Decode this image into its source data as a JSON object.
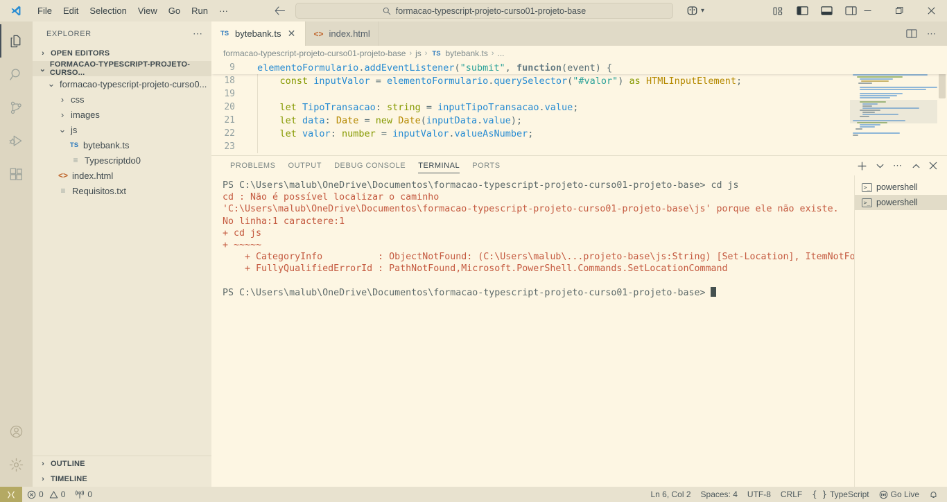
{
  "titlebar": {
    "menus": [
      "File",
      "Edit",
      "Selection",
      "View",
      "Go",
      "Run",
      "···"
    ],
    "search_value": "formacao-typescript-projeto-curso01-projeto-base",
    "search_icon": "search-icon",
    "back_icon": "arrow-left-icon",
    "forward_icon": "arrow-right-icon",
    "accounts_icon": "remote-explorer-icon",
    "layout_icons": [
      "customize-layout-icon",
      "toggle-primary-sidebar-icon",
      "toggle-panel-icon",
      "toggle-secondary-sidebar-icon"
    ],
    "window": {
      "minimize": "─",
      "maximize": "❐",
      "close": "✕"
    }
  },
  "activitybar": {
    "items": [
      {
        "name": "explorer",
        "icon": "files-icon",
        "active": true
      },
      {
        "name": "search",
        "icon": "search-icon",
        "active": false
      },
      {
        "name": "source-control",
        "icon": "source-control-icon",
        "active": false
      },
      {
        "name": "run-and-debug",
        "icon": "run-debug-icon",
        "active": false
      },
      {
        "name": "extensions",
        "icon": "extensions-icon",
        "active": false
      }
    ],
    "bottom": [
      {
        "name": "accounts",
        "icon": "account-icon"
      },
      {
        "name": "manage",
        "icon": "gear-icon"
      }
    ]
  },
  "sidebar": {
    "title": "EXPLORER",
    "more_actions": "⋯",
    "sections": [
      {
        "label": "OPEN EDITORS",
        "expanded": false
      },
      {
        "label": "FORMACAO-TYPESCRIPT-PROJETO-CURSO...",
        "expanded": true
      }
    ],
    "tree": [
      {
        "label": "formacao-typescript-projeto-curso0...",
        "indent": 1,
        "chev": "⌄",
        "icon": "folder",
        "type": "folder"
      },
      {
        "label": "css",
        "indent": 2,
        "chev": "›",
        "icon": "folder",
        "type": "folder"
      },
      {
        "label": "images",
        "indent": 2,
        "chev": "›",
        "icon": "folder",
        "type": "folder"
      },
      {
        "label": "js",
        "indent": 2,
        "chev": "⌄",
        "icon": "folder",
        "type": "folder"
      },
      {
        "label": "bytebank.ts",
        "indent": 3,
        "chev": "",
        "icon": "ts-file-icon",
        "type": "ts"
      },
      {
        "label": "Typescriptdo0",
        "indent": 3,
        "chev": "",
        "icon": "text-file-icon",
        "type": "txt"
      },
      {
        "label": "index.html",
        "indent": 2,
        "chev": "",
        "icon": "html-file-icon",
        "type": "html"
      },
      {
        "label": "Requisitos.txt",
        "indent": 2,
        "chev": "",
        "icon": "text-file-icon",
        "type": "txt"
      }
    ],
    "bottom_sections": [
      {
        "label": "OUTLINE",
        "expanded": false
      },
      {
        "label": "TIMELINE",
        "expanded": false
      }
    ]
  },
  "editor": {
    "tabs": [
      {
        "label": "bytebank.ts",
        "icon": "ts-file-icon",
        "active": true,
        "close": "✕"
      },
      {
        "label": "index.html",
        "icon": "html-file-icon",
        "active": false,
        "close": ""
      }
    ],
    "actions": [
      "split-editor-icon",
      "more-actions-icon"
    ],
    "breadcrumb": [
      "formacao-typescript-projeto-curso01-projeto-base",
      "js",
      "bytebank.ts",
      "..."
    ],
    "breadcrumb_sep": "›",
    "sticky_line": {
      "number": "9",
      "tokens": [
        {
          "t": "elementoFormulario",
          "c": "t-var"
        },
        {
          "t": ".",
          "c": "t-punct"
        },
        {
          "t": "addEventListener",
          "c": "t-var"
        },
        {
          "t": "(",
          "c": "t-punct"
        },
        {
          "t": "\"submit\"",
          "c": "t-str"
        },
        {
          "t": ", ",
          "c": "t-punct"
        },
        {
          "t": "function",
          "c": "t-fn"
        },
        {
          "t": "(",
          "c": "t-punct"
        },
        {
          "t": "event",
          "c": "t-plain"
        },
        {
          "t": ") {",
          "c": "t-punct"
        }
      ]
    },
    "lines": [
      {
        "number": "18",
        "indent": 4,
        "tokens": [
          {
            "t": "const",
            "c": "t-kw"
          },
          {
            "t": " ",
            "c": "t-plain"
          },
          {
            "t": "inputValor",
            "c": "t-var"
          },
          {
            "t": " = ",
            "c": "t-punct"
          },
          {
            "t": "elementoFormulario",
            "c": "t-var"
          },
          {
            "t": ".",
            "c": "t-punct"
          },
          {
            "t": "querySelector",
            "c": "t-var"
          },
          {
            "t": "(",
            "c": "t-punct"
          },
          {
            "t": "\"#valor\"",
            "c": "t-str"
          },
          {
            "t": ") ",
            "c": "t-punct"
          },
          {
            "t": "as",
            "c": "t-kw"
          },
          {
            "t": " ",
            "c": "t-plain"
          },
          {
            "t": "HTMLInputElement",
            "c": "t-type"
          },
          {
            "t": ";",
            "c": "t-punct"
          }
        ]
      },
      {
        "number": "19",
        "indent": 0,
        "tokens": []
      },
      {
        "number": "20",
        "indent": 4,
        "tokens": [
          {
            "t": "let",
            "c": "t-kw"
          },
          {
            "t": " ",
            "c": "t-plain"
          },
          {
            "t": "TipoTransacao",
            "c": "t-var"
          },
          {
            "t": ": ",
            "c": "t-punct"
          },
          {
            "t": "string",
            "c": "t-kw"
          },
          {
            "t": " = ",
            "c": "t-punct"
          },
          {
            "t": "inputTipoTransacao",
            "c": "t-var"
          },
          {
            "t": ".",
            "c": "t-punct"
          },
          {
            "t": "value",
            "c": "t-prop"
          },
          {
            "t": ";",
            "c": "t-punct"
          }
        ]
      },
      {
        "number": "21",
        "indent": 4,
        "tokens": [
          {
            "t": "let",
            "c": "t-kw"
          },
          {
            "t": " ",
            "c": "t-plain"
          },
          {
            "t": "data",
            "c": "t-var"
          },
          {
            "t": ": ",
            "c": "t-punct"
          },
          {
            "t": "Date",
            "c": "t-type"
          },
          {
            "t": " = ",
            "c": "t-punct"
          },
          {
            "t": "new",
            "c": "t-kw"
          },
          {
            "t": " ",
            "c": "t-plain"
          },
          {
            "t": "Date",
            "c": "t-type"
          },
          {
            "t": "(",
            "c": "t-punct"
          },
          {
            "t": "inputData",
            "c": "t-var"
          },
          {
            "t": ".",
            "c": "t-punct"
          },
          {
            "t": "value",
            "c": "t-prop"
          },
          {
            "t": ");",
            "c": "t-punct"
          }
        ]
      },
      {
        "number": "22",
        "indent": 4,
        "tokens": [
          {
            "t": "let",
            "c": "t-kw"
          },
          {
            "t": " ",
            "c": "t-plain"
          },
          {
            "t": "valor",
            "c": "t-var"
          },
          {
            "t": ": ",
            "c": "t-punct"
          },
          {
            "t": "number",
            "c": "t-kw"
          },
          {
            "t": " = ",
            "c": "t-punct"
          },
          {
            "t": "inputValor",
            "c": "t-var"
          },
          {
            "t": ".",
            "c": "t-punct"
          },
          {
            "t": "valueAsNumber",
            "c": "t-prop"
          },
          {
            "t": ";",
            "c": "t-punct"
          }
        ]
      },
      {
        "number": "23",
        "indent": 0,
        "tokens": []
      }
    ]
  },
  "panel": {
    "tabs": [
      {
        "label": "PROBLEMS",
        "active": false
      },
      {
        "label": "OUTPUT",
        "active": false
      },
      {
        "label": "DEBUG CONSOLE",
        "active": false
      },
      {
        "label": "TERMINAL",
        "active": true
      },
      {
        "label": "PORTS",
        "active": false
      }
    ],
    "actions": [
      "new-terminal-icon",
      "chevron-down-icon",
      "more-actions-icon",
      "chevron-up-icon",
      "close-icon"
    ],
    "terminal_lines": [
      {
        "text": "PS C:\\Users\\malub\\OneDrive\\Documentos\\formacao-typescript-projeto-curso01-projeto-base> cd js",
        "style": "normal"
      },
      {
        "text": "cd : Não é possível localizar o caminho",
        "style": "error"
      },
      {
        "text": "'C:\\Users\\malub\\OneDrive\\Documentos\\formacao-typescript-projeto-curso01-projeto-base\\js' porque ele não existe.",
        "style": "error"
      },
      {
        "text": "No linha:1 caractere:1",
        "style": "error"
      },
      {
        "text": "+ cd js",
        "style": "error"
      },
      {
        "text": "+ ~~~~~",
        "style": "error"
      },
      {
        "text": "    + CategoryInfo          : ObjectNotFound: (C:\\Users\\malub\\...projeto-base\\js:String) [Set-Location], ItemNotFoundException",
        "style": "error"
      },
      {
        "text": "    + FullyQualifiedErrorId : PathNotFound,Microsoft.PowerShell.Commands.SetLocationCommand",
        "style": "error"
      },
      {
        "text": "",
        "style": "normal"
      },
      {
        "text": "PS C:\\Users\\malub\\OneDrive\\Documentos\\formacao-typescript-projeto-curso01-projeto-base> ",
        "style": "prompt"
      }
    ],
    "terminal_list": [
      {
        "label": "powershell",
        "icon": "terminal-icon",
        "active": false
      },
      {
        "label": "powershell",
        "icon": "terminal-icon",
        "active": true
      }
    ]
  },
  "statusbar": {
    "remote_icon": "remote-host-icon",
    "left": [
      {
        "label": "0",
        "icon": "error-icon",
        "name": "errors-count"
      },
      {
        "label": "0",
        "icon": "warning-icon",
        "name": "warnings-count"
      },
      {
        "label": "0",
        "icon": "radio-tower-icon",
        "name": "ports-count"
      }
    ],
    "right": [
      {
        "label": "Ln 6, Col 2",
        "name": "cursor-position"
      },
      {
        "label": "Spaces: 4",
        "name": "indentation"
      },
      {
        "label": "UTF-8",
        "name": "encoding"
      },
      {
        "label": "CRLF",
        "name": "eol"
      },
      {
        "label": "TypeScript",
        "name": "language-mode",
        "icon": "braces-icon"
      },
      {
        "label": "Go Live",
        "name": "go-live",
        "icon": "broadcast-icon"
      },
      {
        "label": "",
        "name": "notifications",
        "icon": "bell-icon"
      }
    ]
  },
  "colors": {
    "titlebar_bg": "#e8e2cf",
    "activitybar_bg": "#ddd6c1",
    "sidebar_bg": "#eee8d5",
    "editor_bg": "#fdf6e3",
    "tabbar_bg": "#e0dac7",
    "accent_blue": "#268bd2",
    "error_red": "#c4593f",
    "remote_badge": "#b4a963"
  },
  "minimap_lines": [
    {
      "w": 28,
      "c": "#6b9ec9",
      "ml": 0
    },
    {
      "w": 0,
      "c": "transparent",
      "ml": 0
    },
    {
      "w": 96,
      "c": "#8fb7d8",
      "ml": 0
    },
    {
      "w": 54,
      "c": "#8aa95f",
      "ml": 4
    },
    {
      "w": 8,
      "c": "#9aa5a5",
      "ml": 0
    },
    {
      "w": 0,
      "c": "transparent",
      "ml": 0
    },
    {
      "w": 108,
      "c": "#8fb7d8",
      "ml": 0
    },
    {
      "w": 66,
      "c": "#9fb873",
      "ml": 6
    },
    {
      "w": 48,
      "c": "#8fb7d8",
      "ml": 10
    },
    {
      "w": 40,
      "c": "#c9b46a",
      "ml": 12
    },
    {
      "w": 20,
      "c": "#9aa5a5",
      "ml": 8
    },
    {
      "w": 0,
      "c": "transparent",
      "ml": 0
    },
    {
      "w": 112,
      "c": "#8fb7d8",
      "ml": 10
    },
    {
      "w": 96,
      "c": "#8fb7d8",
      "ml": 10
    },
    {
      "w": 0,
      "c": "transparent",
      "ml": 0
    },
    {
      "w": 62,
      "c": "#8fb7d8",
      "ml": 10
    },
    {
      "w": 54,
      "c": "#8fb7d8",
      "ml": 10
    },
    {
      "w": 44,
      "c": "#8fb7d8",
      "ml": 10
    },
    {
      "w": 0,
      "c": "transparent",
      "ml": 0
    },
    {
      "w": 38,
      "c": "#9fb873",
      "ml": 10
    },
    {
      "w": 22,
      "c": "#8fb7d8",
      "ml": 14
    },
    {
      "w": 14,
      "c": "#9aa5a5",
      "ml": 14
    },
    {
      "w": 82,
      "c": "#8fb7d8",
      "ml": 14
    },
    {
      "w": 30,
      "c": "#9aa5a5",
      "ml": 10
    },
    {
      "w": 18,
      "c": "#9aa5a5",
      "ml": 14
    },
    {
      "w": 52,
      "c": "#8fb7d8",
      "ml": 14
    },
    {
      "w": 14,
      "c": "#9aa5a5",
      "ml": 10
    },
    {
      "w": 0,
      "c": "transparent",
      "ml": 0
    },
    {
      "w": 76,
      "c": "#8fb7d8",
      "ml": 0
    },
    {
      "w": 44,
      "c": "#9fb873",
      "ml": 6
    },
    {
      "w": 30,
      "c": "#8fb7d8",
      "ml": 10
    },
    {
      "w": 22,
      "c": "#8fb7d8",
      "ml": 10
    },
    {
      "w": 10,
      "c": "#9aa5a5",
      "ml": 4
    },
    {
      "w": 0,
      "c": "transparent",
      "ml": 0
    },
    {
      "w": 68,
      "c": "#8fb7d8",
      "ml": 0
    },
    {
      "w": 8,
      "c": "#9aa5a5",
      "ml": 0
    }
  ]
}
